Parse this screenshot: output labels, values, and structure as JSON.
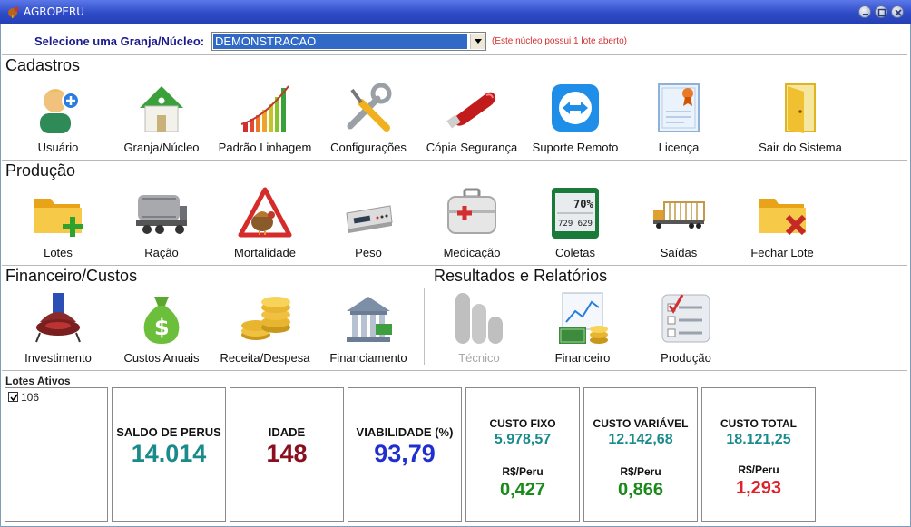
{
  "window": {
    "title": "AGROPERU"
  },
  "selector": {
    "label": "Selecione uma Granja/Núcleo:",
    "value": "DEMONSTRACAO",
    "note": "(Este núcleo possui 1 lote aberto)"
  },
  "cadastros": {
    "title": "Cadastros",
    "items": [
      {
        "label": "Usuário",
        "icon": "user-add-icon"
      },
      {
        "label": "Granja/Núcleo",
        "icon": "farm-house-icon"
      },
      {
        "label": "Padrão Linhagem",
        "icon": "growth-chart-icon"
      },
      {
        "label": "Configurações",
        "icon": "tools-icon"
      },
      {
        "label": "Cópia Segurança",
        "icon": "usb-drive-icon"
      },
      {
        "label": "Suporte Remoto",
        "icon": "remote-support-icon"
      },
      {
        "label": "Licença",
        "icon": "certificate-icon"
      },
      {
        "label": "Sair do Sistema",
        "icon": "exit-door-icon"
      }
    ]
  },
  "producao": {
    "title": "Produção",
    "items": [
      {
        "label": "Lotes",
        "icon": "folder-add-icon"
      },
      {
        "label": "Ração",
        "icon": "feed-truck-icon"
      },
      {
        "label": "Mortalidade",
        "icon": "turkey-warning-icon"
      },
      {
        "label": "Peso",
        "icon": "scale-icon"
      },
      {
        "label": "Medicação",
        "icon": "first-aid-kit-icon"
      },
      {
        "label": "Coletas",
        "icon": "thermometer-display-icon"
      },
      {
        "label": "Saídas",
        "icon": "transport-truck-icon"
      },
      {
        "label": "Fechar Lote",
        "icon": "folder-close-icon"
      }
    ]
  },
  "financeiro": {
    "title": "Financeiro/Custos",
    "items": [
      {
        "label": "Investimento",
        "icon": "feeder-icon"
      },
      {
        "label": "Custos Anuais",
        "icon": "money-bag-icon"
      },
      {
        "label": "Receita/Despesa",
        "icon": "coins-icon"
      },
      {
        "label": "Financiamento",
        "icon": "bank-icon"
      }
    ]
  },
  "resultados": {
    "title": "Resultados e Relatórios",
    "items": [
      {
        "label": "Técnico",
        "icon": "bar-chart-icon",
        "disabled": true
      },
      {
        "label": "Financeiro",
        "icon": "financial-report-icon"
      },
      {
        "label": "Produção",
        "icon": "checklist-icon"
      }
    ]
  },
  "lotes_ativos": {
    "title": "Lotes Ativos",
    "items": [
      {
        "label": "106",
        "checked": true
      }
    ]
  },
  "stats": {
    "saldo_label": "SALDO DE PERUS",
    "saldo_value": "14.014",
    "idade_label": "IDADE",
    "idade_value": "148",
    "viabilidade_label": "VIABILIDADE (%)",
    "viabilidade_value": "93,79",
    "custo_fixo_label": "CUSTO FIXO",
    "custo_fixo_value": "5.978,57",
    "custo_fixo_pp_label": "R$/Peru",
    "custo_fixo_pp_value": "0,427",
    "custo_variavel_label": "CUSTO VARIÁVEL",
    "custo_variavel_value": "12.142,68",
    "custo_variavel_pp_label": "R$/Peru",
    "custo_variavel_pp_value": "0,866",
    "custo_total_label": "CUSTO TOTAL",
    "custo_total_value": "18.121,25",
    "custo_total_pp_label": "R$/Peru",
    "custo_total_pp_value": "1,293"
  },
  "colors": {
    "teal": "#1a8a8a",
    "maroon": "#8a1020",
    "blue": "#1f2fd0",
    "green": "#1a8a1a",
    "red": "#e0202a"
  }
}
